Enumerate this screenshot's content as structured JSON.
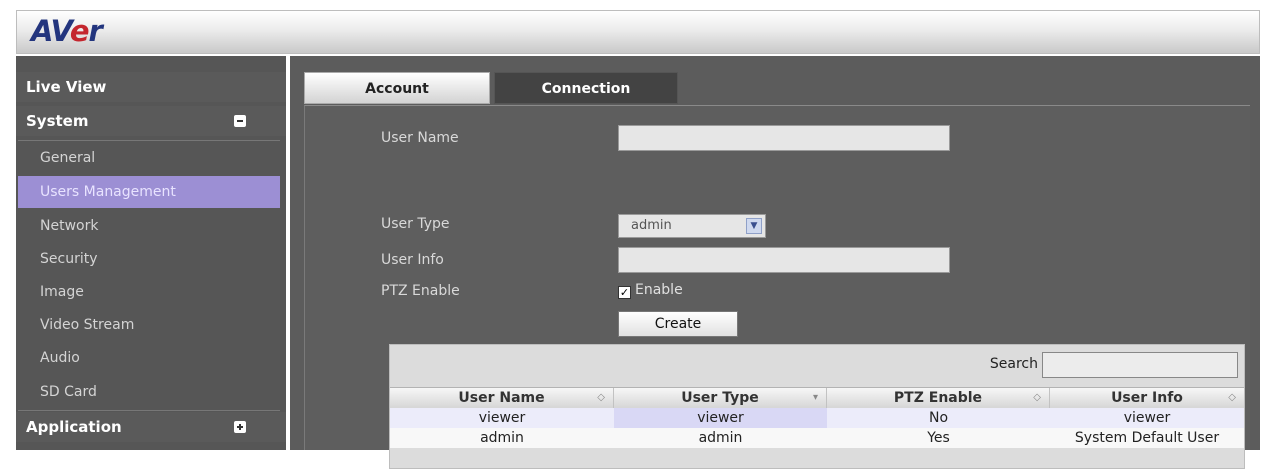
{
  "header": {
    "logo_text_1": "AV",
    "logo_text_2": "e",
    "logo_text_3": "r"
  },
  "sidebar": {
    "live_view": "Live View",
    "system": "System",
    "items": [
      "General",
      "Users Management",
      "Network",
      "Security",
      "Image",
      "Video Stream",
      "Audio",
      "SD Card"
    ],
    "active_item": "Users Management",
    "application": "Application"
  },
  "tabs": {
    "account": "Account",
    "connection": "Connection"
  },
  "form": {
    "user_name_label": "User Name",
    "user_type_label": "User Type",
    "user_type_value": "admin",
    "user_info_label": "User Info",
    "ptz_label": "PTZ Enable",
    "ptz_checkbox_label": "Enable",
    "ptz_checked": true,
    "create_button": "Create"
  },
  "table": {
    "search_label": "Search",
    "columns": [
      "User Name",
      "User Type",
      "PTZ Enable",
      "User Info"
    ],
    "rows": [
      [
        "viewer",
        "viewer",
        "No",
        "viewer"
      ],
      [
        "admin",
        "admin",
        "Yes",
        "System Default User"
      ]
    ]
  },
  "colors": {
    "accent_active": "#9c8fd4",
    "logo_blue": "#23357e",
    "logo_red": "#c4262e"
  }
}
